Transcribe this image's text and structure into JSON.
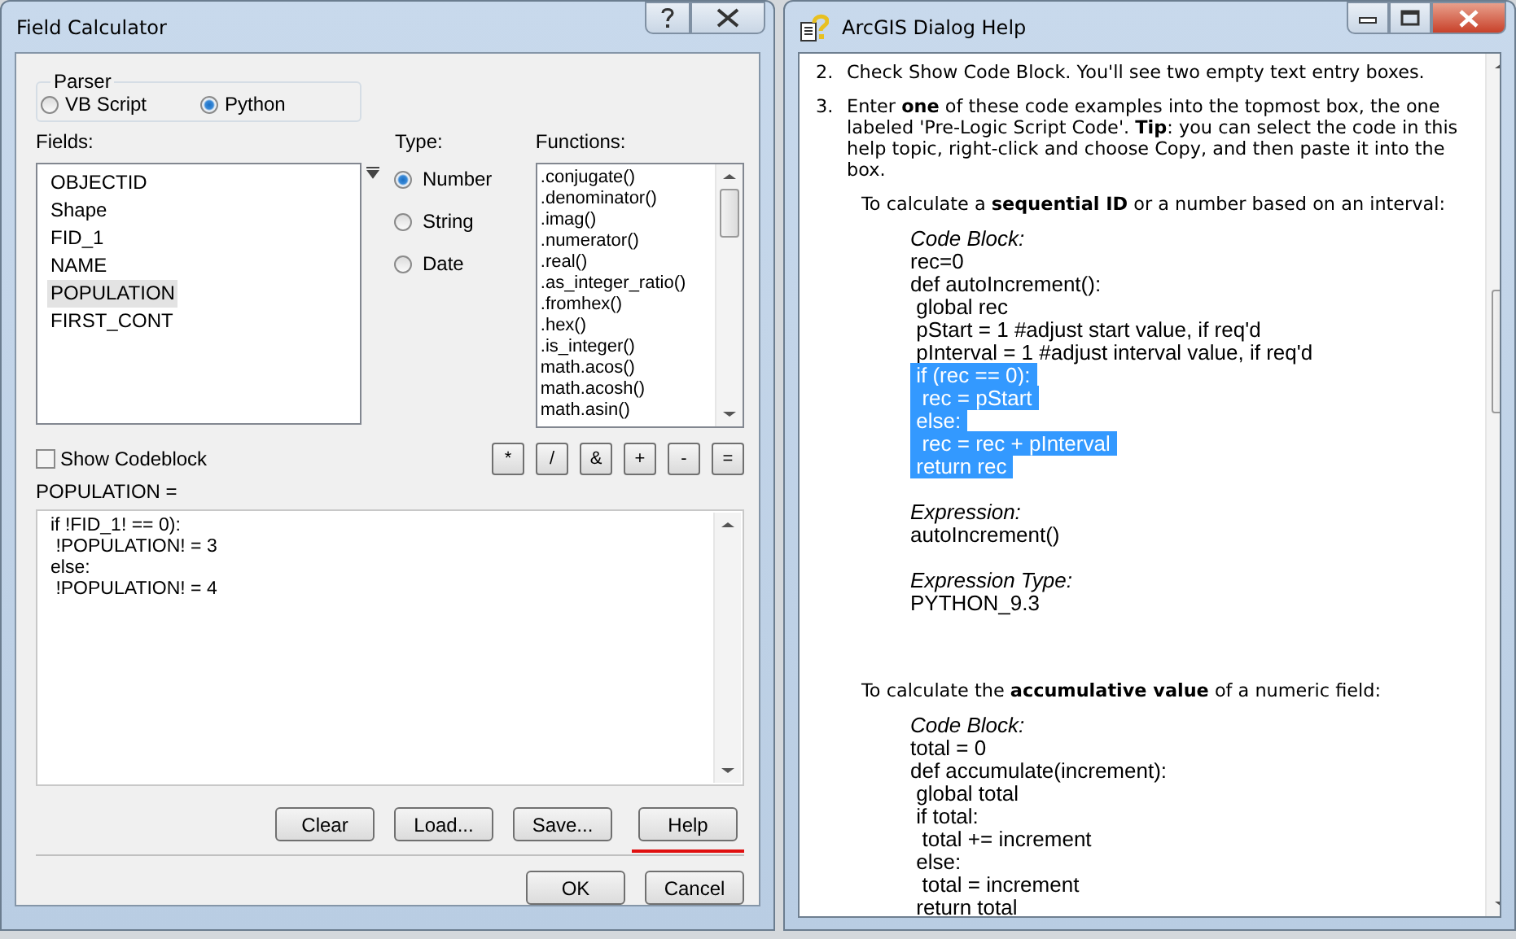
{
  "field_calculator": {
    "title": "Field Calculator",
    "parser": {
      "label": "Parser",
      "options": [
        {
          "label": "VB Script",
          "selected": false
        },
        {
          "label": "Python",
          "selected": true
        }
      ]
    },
    "fields": {
      "label": "Fields:",
      "items": [
        {
          "label": "OBJECTID",
          "selected": false
        },
        {
          "label": "Shape",
          "selected": false
        },
        {
          "label": "FID_1",
          "selected": false
        },
        {
          "label": "NAME",
          "selected": false
        },
        {
          "label": "POPULATION",
          "selected": true
        },
        {
          "label": "FIRST_CONT",
          "selected": false
        }
      ]
    },
    "type": {
      "label": "Type:",
      "options": [
        {
          "label": "Number",
          "selected": true
        },
        {
          "label": "String",
          "selected": false
        },
        {
          "label": "Date",
          "selected": false
        }
      ]
    },
    "functions": {
      "label": "Functions:",
      "items": [
        ".conjugate()",
        ".denominator()",
        ".imag()",
        ".numerator()",
        ".real()",
        ".as_integer_ratio()",
        ".fromhex()",
        ".hex()",
        ".is_integer()",
        "math.acos()",
        "math.acosh()",
        "math.asin()"
      ]
    },
    "show_codeblock": {
      "label": "Show Codeblock",
      "checked": false
    },
    "operators": [
      "*",
      "/",
      "&",
      "+",
      "-",
      "="
    ],
    "expression_label": "POPULATION =",
    "expression": [
      "if !FID_1! == 0):",
      " !POPULATION! = 3",
      "else:",
      " !POPULATION! = 4"
    ],
    "tool_buttons": [
      {
        "label": "Clear",
        "underlined": false
      },
      {
        "label": "Load...",
        "underlined": false
      },
      {
        "label": "Save...",
        "underlined": false
      },
      {
        "label": "Help",
        "underlined": true
      }
    ],
    "dialog_buttons": [
      "OK",
      "Cancel"
    ]
  },
  "help_window": {
    "title": "ArcGIS Dialog Help",
    "steps": [
      {
        "number": "2.",
        "text": "Check Show Code Block. You'll see two empty text entry boxes."
      },
      {
        "number": "3.",
        "text": "Enter **one** of these code examples into the topmost box, the one labeled 'Pre-Logic Script Code'. **Tip**: you can select the code in this help topic, right-click and choose Copy, and then paste it into the box."
      }
    ],
    "examples": [
      {
        "intro": "To calculate a **sequential ID** or a number based on an interval:",
        "parts": [
          {
            "label": "Code Block:",
            "lines": [
              {
                "text": "rec=0",
                "highlighted": false
              },
              {
                "text": "def autoIncrement():",
                "highlighted": false
              },
              {
                "text": " global rec",
                "highlighted": false
              },
              {
                "text": " pStart = 1 #adjust start value, if req'd",
                "highlighted": false
              },
              {
                "text": " pInterval = 1 #adjust interval value, if req'd",
                "highlighted": false
              },
              {
                "text": " if (rec == 0):",
                "highlighted": true
              },
              {
                "text": "  rec = pStart",
                "highlighted": true
              },
              {
                "text": " else:",
                "highlighted": true
              },
              {
                "text": "  rec = rec + pInterval",
                "highlighted": true
              },
              {
                "text": " return rec",
                "highlighted": true
              }
            ]
          },
          {
            "label": "Expression:",
            "lines": [
              {
                "text": "autoIncrement()",
                "highlighted": false
              }
            ]
          },
          {
            "label": "Expression Type:",
            "lines": [
              {
                "text": "PYTHON_9.3",
                "highlighted": false
              }
            ]
          }
        ]
      },
      {
        "intro": "To calculate the **accumulative value** of a numeric field:",
        "parts": [
          {
            "label": "Code Block:",
            "lines": [
              {
                "text": "total = 0",
                "highlighted": false
              },
              {
                "text": "def accumulate(increment):",
                "highlighted": false
              },
              {
                "text": " global total",
                "highlighted": false
              },
              {
                "text": " if total:",
                "highlighted": false
              },
              {
                "text": "  total += increment",
                "highlighted": false
              },
              {
                "text": " else:",
                "highlighted": false
              },
              {
                "text": "  total = increment",
                "highlighted": false
              },
              {
                "text": " return total",
                "highlighted": false
              }
            ]
          }
        ]
      }
    ]
  }
}
